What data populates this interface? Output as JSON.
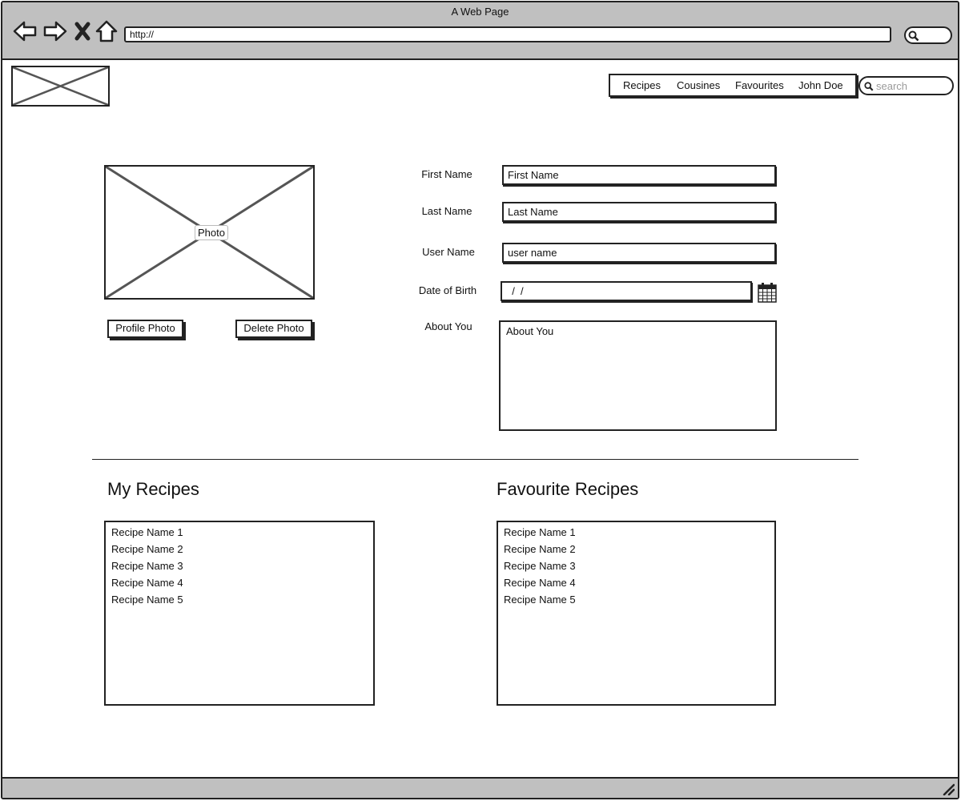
{
  "window": {
    "title": "A Web Page"
  },
  "browser": {
    "url": "http://"
  },
  "nav": {
    "items": [
      {
        "label": "Recipes"
      },
      {
        "label": "Cousines"
      },
      {
        "label": "Favourites"
      },
      {
        "label": "John Doe"
      }
    ],
    "search_placeholder": "search"
  },
  "profile": {
    "photo_label": "Photo",
    "profile_photo_button": "Profile Photo",
    "delete_photo_button": "Delete Photo"
  },
  "form": {
    "first_name": {
      "label": "First Name",
      "value": "First Name"
    },
    "last_name": {
      "label": "Last Name",
      "value": "Last Name"
    },
    "user_name": {
      "label": "User Name",
      "value": "user name"
    },
    "date_of_birth": {
      "label": "Date of Birth",
      "value": "  /  /"
    },
    "about_you": {
      "label": "About You",
      "value": "About You"
    }
  },
  "my_recipes": {
    "title": "My Recipes",
    "items": [
      "Recipe Name 1",
      "Recipe Name 2",
      "Recipe Name 3",
      "Recipe Name 4",
      "Recipe Name 5"
    ]
  },
  "favourite_recipes": {
    "title": "Favourite Recipes",
    "items": [
      "Recipe Name 1",
      "Recipe Name 2",
      "Recipe Name 3",
      "Recipe Name 4",
      "Recipe Name 5"
    ]
  },
  "icons": {
    "back": "back-arrow-icon",
    "forward": "forward-arrow-icon",
    "stop": "close-icon",
    "home": "home-icon",
    "search": "search-icon",
    "calendar": "calendar-icon",
    "resize": "resize-grip-icon"
  }
}
